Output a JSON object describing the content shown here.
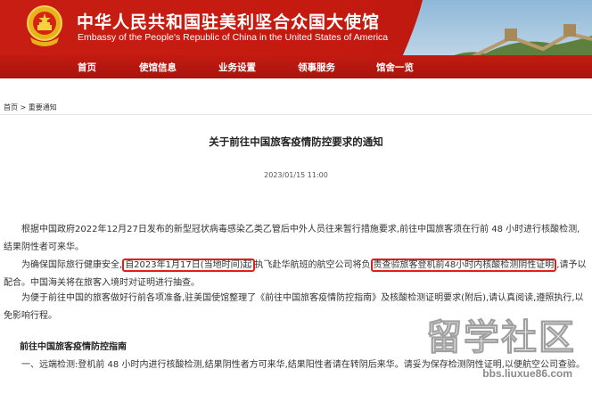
{
  "header": {
    "title": "中华人民共和国驻美利坚合众国大使馆",
    "subtitle": "Embassy of the People's Republic of China in the United States of America"
  },
  "nav": {
    "items": [
      {
        "label": "首页"
      },
      {
        "label": "使馆信息"
      },
      {
        "label": "业务设置"
      },
      {
        "label": "领事服务"
      },
      {
        "label": "馆舍一览"
      }
    ]
  },
  "breadcrumb": {
    "home": "首页",
    "sep": ">",
    "current": "重要通知"
  },
  "article": {
    "title": "关于前往中国旅客疫情防控要求的通知",
    "date": "2023/01/15 11:00",
    "p1": "根据中国政府2022年12月27日发布的新型冠状病毒感染乙类乙管后中外人员往来暂行措施要求,前往中国旅客须在行前 48 小时进行核酸检测,结果阴性者可来华。",
    "p2_a": "为确保国际旅行健康安全,",
    "p2_hl1": "自2023年1月17日(当地时间)起",
    "p2_b": "执飞赴华航班的航空公司将负",
    "p2_hl2": "责查验旅客登机前48小时内核酸检测阴性证明",
    "p2_c": ",请予以配合。中国海关将在旅客入境时对证明进行抽查。",
    "p3": "为便于前往中国的旅客做好行前各项准备,驻美国使馆整理了《前往中国旅客疫情防控指南》及核酸检测证明要求(附后),请认真阅读,遵照执行,以免影响行程。",
    "section_title": "前往中国旅客疫情防控指南",
    "p4": "一、远端检测:登机前 48 小时内进行核酸检测,结果阴性者方可来华,结果阳性者请在转阴后来华。请妥为保存检测阴性证明,以便航空公司查验。"
  },
  "watermark": {
    "text": "留学社区",
    "url": "bbs.liuxue86.com"
  },
  "colors": {
    "header_red": "#c81d12",
    "highlight_border": "#e0201a"
  }
}
